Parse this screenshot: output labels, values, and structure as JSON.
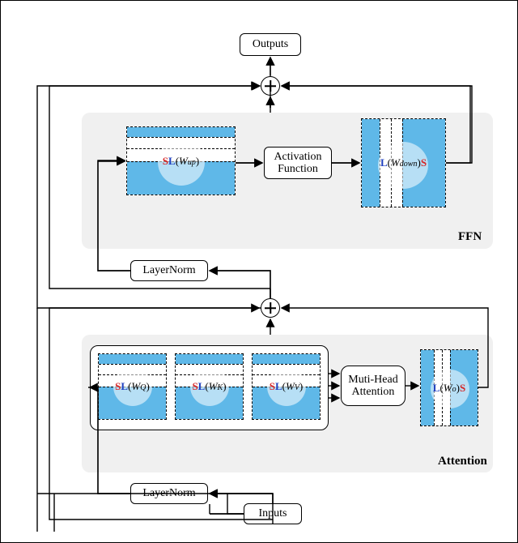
{
  "outputs": "Outputs",
  "inputs": "Inputs",
  "activation_fn": "Activation\nFunction",
  "mha": "Muti-Head\nAttention",
  "layernorm1": "LayerNorm",
  "layernorm2": "LayerNorm",
  "ffn_label": "FFN",
  "attn_label": "Attention",
  "S": "S",
  "L": "L",
  "W_up": "W",
  "W_up_sub": "up",
  "W_down": "W",
  "W_down_sub": "down",
  "W_Q": "W",
  "W_Q_sub": "Q",
  "W_K": "W",
  "W_K_sub": "K",
  "W_V": "W",
  "W_V_sub": "V",
  "W_o": "W",
  "W_o_sub": "o"
}
